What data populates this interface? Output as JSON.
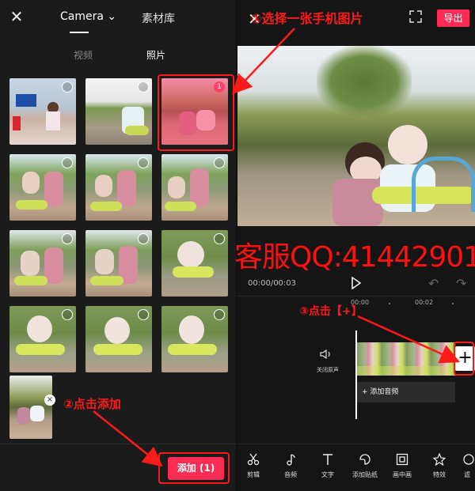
{
  "left_panel": {
    "top_tabs": {
      "camera": "Camera ⌄",
      "library": "素材库"
    },
    "sub_tabs": {
      "video": "视频",
      "photo": "照片"
    },
    "selected_number": "1",
    "selected_remove": "×",
    "add_button": "添加 (1)"
  },
  "right_panel": {
    "close": "✕",
    "export_button": "导出",
    "time": "00:00/00:03",
    "ticks": {
      "t0": "00:00",
      "t2": "00:02"
    },
    "mute_label": "关闭原声",
    "add_clip": "+",
    "add_audio": "+ 添加音频",
    "toolbar": [
      {
        "label": "剪辑",
        "icon": "scissors-icon"
      },
      {
        "label": "音频",
        "icon": "music-note-icon"
      },
      {
        "label": "文字",
        "icon": "text-icon"
      },
      {
        "label": "添加贴纸",
        "icon": "sticker-icon"
      },
      {
        "label": "画中画",
        "icon": "picture-in-picture-icon"
      },
      {
        "label": "特效",
        "icon": "effects-star-icon"
      },
      {
        "label": "滤",
        "icon": "filter-icon"
      }
    ]
  },
  "annotations": {
    "step1": "①选择一张手机图片",
    "step2": "②点击添加",
    "step3": "③点击【+】",
    "watermark": "客服QQ:41442901"
  },
  "colors": {
    "accent": "#fe2c55",
    "annotation": "#ff1a1a"
  }
}
